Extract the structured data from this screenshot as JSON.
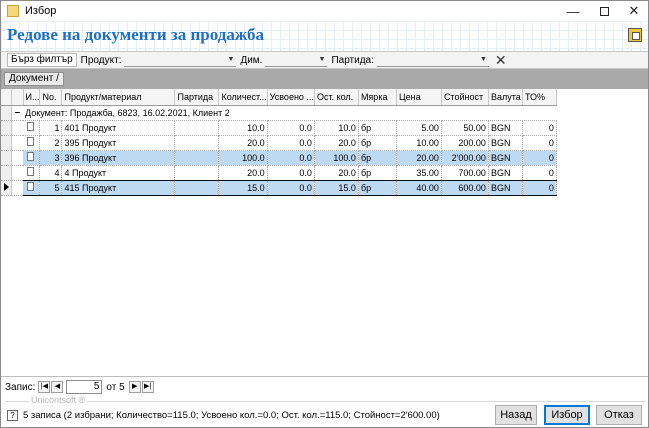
{
  "window": {
    "title": "Избор"
  },
  "header": {
    "page_title": "Редове на документи за продажба"
  },
  "filter": {
    "quick_filter": "Бърз филтър",
    "product_label": "Продукт:",
    "dim_label": "Дим.",
    "batch_label": "Партида:"
  },
  "group_chip": "Документ",
  "columns": [
    "И...",
    "No.",
    "Продукт/материал",
    "Партида",
    "Количест...",
    "Усвоено ...",
    "Ост. кол.",
    "Мярка",
    "Цена",
    "Стойност",
    "Валута",
    "ТО%"
  ],
  "group": {
    "label": "Документ: Продажба, 6823, 16.02.2021, Клиент 2"
  },
  "rows": [
    {
      "no": "1",
      "product": "401 Продукт",
      "batch": "",
      "qty": "10.0",
      "used": "0.0",
      "rest": "10.0",
      "unit": "бр",
      "price": "5.00",
      "value": "50.00",
      "currency": "BGN",
      "to": "0",
      "selected": false,
      "current": false
    },
    {
      "no": "2",
      "product": "395 Продукт",
      "batch": "",
      "qty": "20.0",
      "used": "0.0",
      "rest": "20.0",
      "unit": "бр",
      "price": "10.00",
      "value": "200.00",
      "currency": "BGN",
      "to": "0",
      "selected": false,
      "current": false
    },
    {
      "no": "3",
      "product": "396 Продукт",
      "batch": "",
      "qty": "100.0",
      "used": "0.0",
      "rest": "100.0",
      "unit": "бр",
      "price": "20.00",
      "value": "2'000.00",
      "currency": "BGN",
      "to": "0",
      "selected": true,
      "current": false
    },
    {
      "no": "4",
      "product": "4 Продукт",
      "batch": "",
      "qty": "20.0",
      "used": "0.0",
      "rest": "20.0",
      "unit": "бр",
      "price": "35.00",
      "value": "700.00",
      "currency": "BGN",
      "to": "0",
      "selected": false,
      "current": false
    },
    {
      "no": "5",
      "product": "415 Продукт",
      "batch": "",
      "qty": "15.0",
      "used": "0.0",
      "rest": "15.0",
      "unit": "бр",
      "price": "40.00",
      "value": "600.00",
      "currency": "BGN",
      "to": "0",
      "selected": true,
      "current": true
    }
  ],
  "navigator": {
    "label": "Запис:",
    "current": "5",
    "of_text": "от 5"
  },
  "brand": "Unicontsoft ®",
  "status": {
    "text": "5 записа (2 избрани; Количество=115.0; Усвоено кол.=0.0; Ост. кол.=115.0; Стойност=2'600.00)"
  },
  "buttons": {
    "back": "Назад",
    "select": "Избор",
    "cancel": "Отказ"
  }
}
